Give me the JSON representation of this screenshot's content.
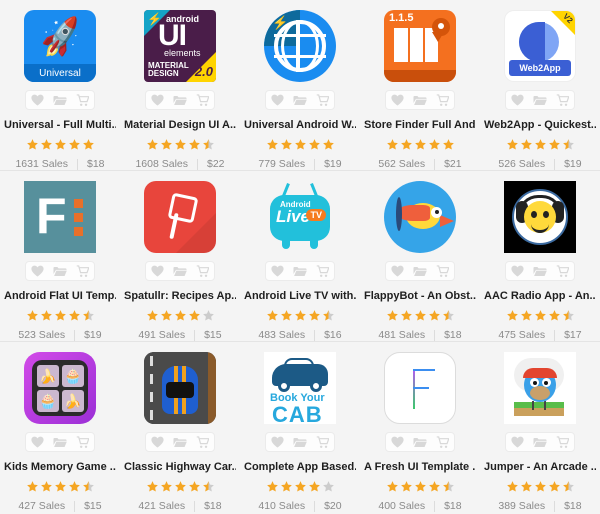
{
  "theme": {
    "page_background": "#f4f4f4",
    "star_color": "#f5a623",
    "star_empty_color": "#cccccc",
    "title_color": "#1f1f1f",
    "meta_color": "#8a8a8a",
    "divider_color": "#e4e4e4"
  },
  "actions": {
    "favorite_label": "favorite",
    "collection_label": "add-to-collection",
    "cart_label": "add-to-cart"
  },
  "labels": {
    "sales_suffix": "Sales"
  },
  "items": [
    {
      "title": "Universal - Full Multi...",
      "rating": 5,
      "sales": "1631 Sales",
      "price": "$18",
      "thumb": "universal-rocket-icon",
      "thumb_text": "Universal"
    },
    {
      "title": "Material Design UI A...",
      "rating": 4.5,
      "sales": "1608 Sales",
      "price": "$22",
      "thumb": "material-design-ui-icon",
      "thumb_text": "android UI elements MATERIAL DESIGN 2.0"
    },
    {
      "title": "Universal Android W...",
      "rating": 5,
      "sales": "779 Sales",
      "price": "$19",
      "thumb": "globe-icon",
      "thumb_text": ""
    },
    {
      "title": "Store Finder Full And...",
      "rating": 5,
      "sales": "562 Sales",
      "price": "$21",
      "thumb": "store-finder-map-icon",
      "thumb_text": "1.1.5"
    },
    {
      "title": "Web2App - Quickest...",
      "rating": 4.5,
      "sales": "526 Sales",
      "price": "$19",
      "thumb": "web2app-icon",
      "thumb_text": "Web2App"
    },
    {
      "title": "Android Flat UI Temp...",
      "rating": 4.5,
      "sales": "523 Sales",
      "price": "$19",
      "thumb": "flat-ui-f-icon",
      "thumb_text": "F"
    },
    {
      "title": "Spatullr: Recipes Ap...",
      "rating": 4,
      "sales": "491 Sales",
      "price": "$15",
      "thumb": "spatula-icon",
      "thumb_text": ""
    },
    {
      "title": "Android Live TV with...",
      "rating": 4.5,
      "sales": "483 Sales",
      "price": "$16",
      "thumb": "live-tv-icon",
      "thumb_text": "Android Live TV"
    },
    {
      "title": "FlappyBot - An Obst...",
      "rating": 4.5,
      "sales": "481 Sales",
      "price": "$18",
      "thumb": "flappybot-bird-icon",
      "thumb_text": ""
    },
    {
      "title": "AAC Radio App - An...",
      "rating": 4.5,
      "sales": "475 Sales",
      "price": "$17",
      "thumb": "aac-radio-headphones-icon",
      "thumb_text": ""
    },
    {
      "title": "Kids Memory Game ...",
      "rating": 4.5,
      "sales": "427 Sales",
      "price": "$15",
      "thumb": "kids-memory-game-icon",
      "thumb_text": ""
    },
    {
      "title": "Classic Highway Car...",
      "rating": 4.5,
      "sales": "421 Sales",
      "price": "$18",
      "thumb": "highway-car-icon",
      "thumb_text": ""
    },
    {
      "title": "Complete App Based..",
      "rating": 4,
      "sales": "410 Sales",
      "price": "$20",
      "thumb": "book-your-cab-icon",
      "thumb_text": "Book Your CAB"
    },
    {
      "title": "A Fresh UI Template ...",
      "rating": 4.5,
      "sales": "400 Sales",
      "price": "$18",
      "thumb": "fresh-ui-f-icon",
      "thumb_text": "F"
    },
    {
      "title": "Jumper - An Arcade ...",
      "rating": 4.5,
      "sales": "389 Sales",
      "price": "$18",
      "thumb": "jumper-bird-icon",
      "thumb_text": ""
    }
  ]
}
